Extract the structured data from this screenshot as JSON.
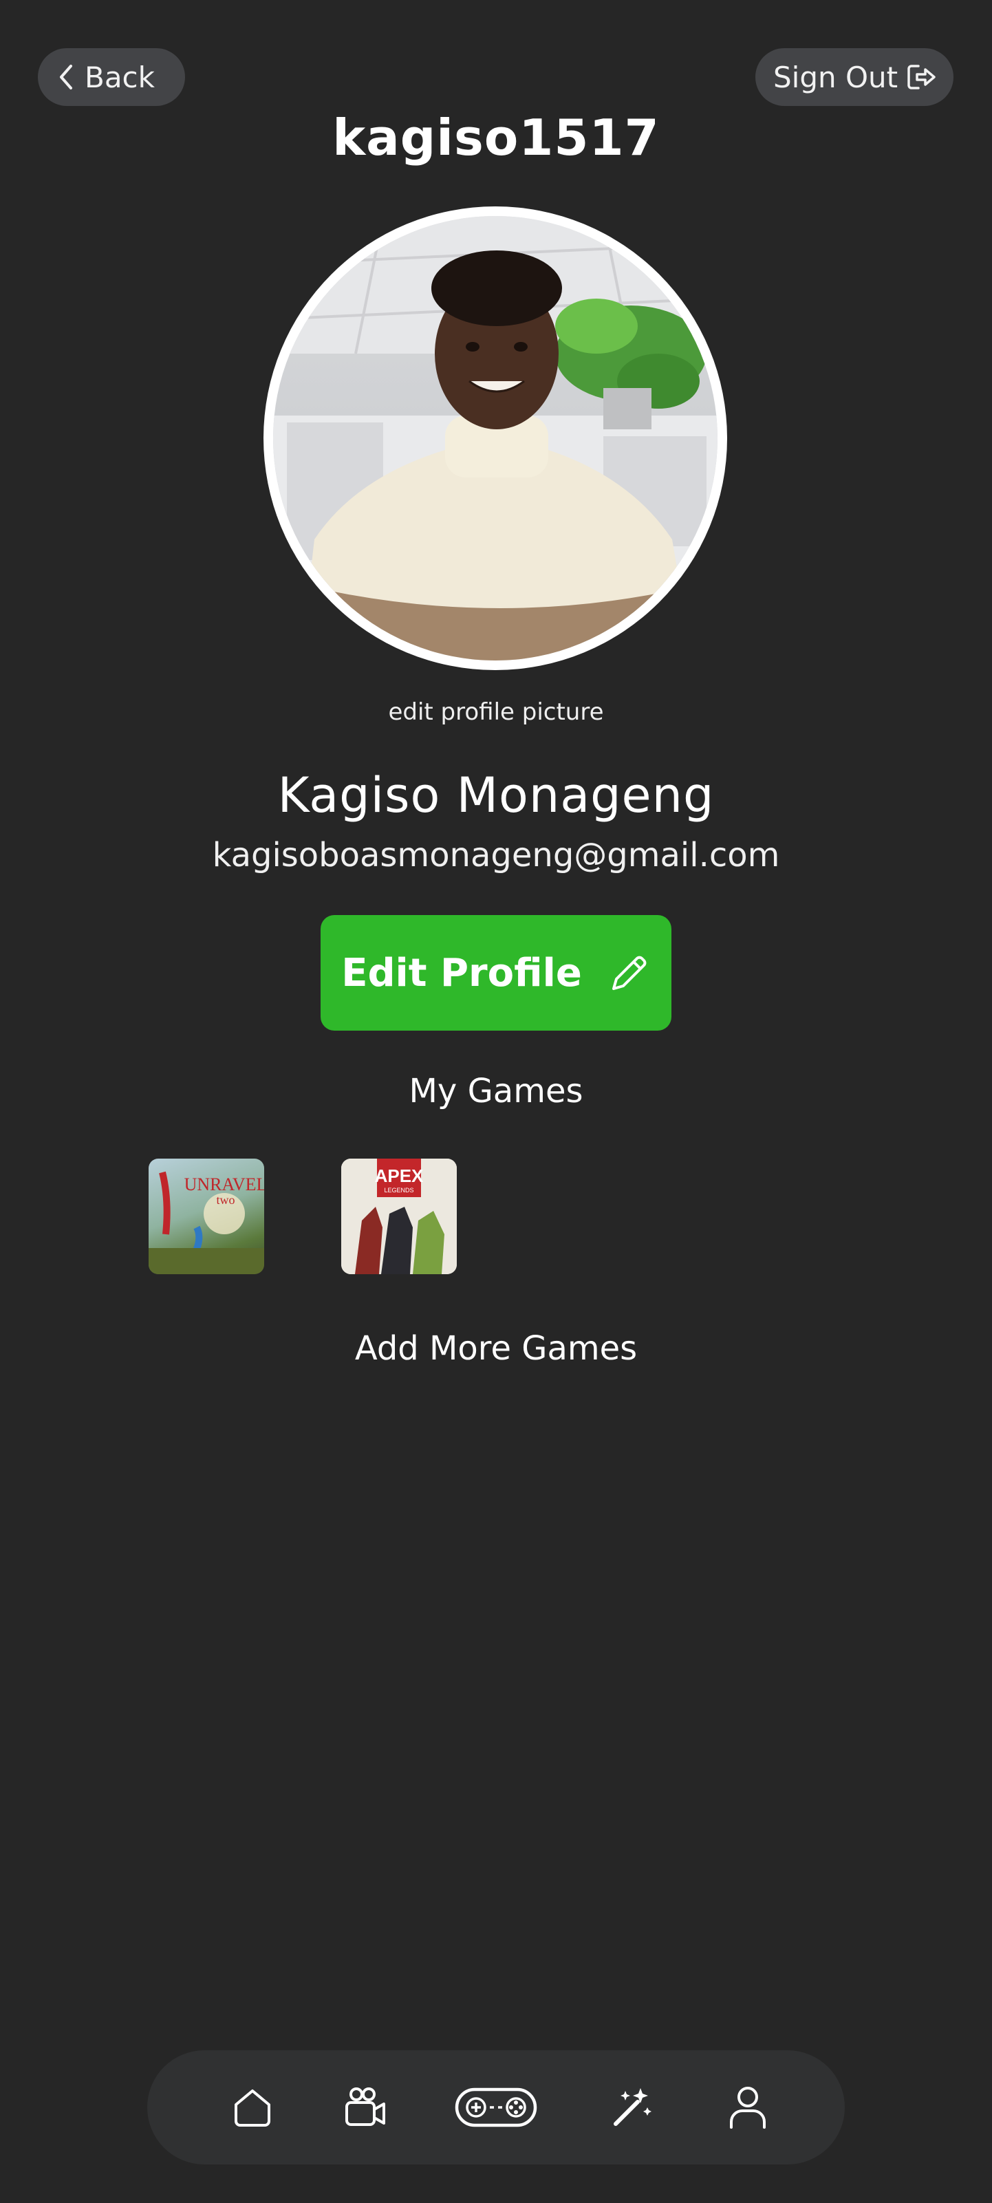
{
  "header": {
    "back_label": "Back",
    "signout_label": "Sign Out",
    "username": "kagiso1517"
  },
  "profile": {
    "edit_picture_label": "edit profile picture",
    "full_name": "Kagiso Monageng",
    "email": "kagisoboasmonageng@gmail.com",
    "edit_button_label": "Edit Profile"
  },
  "games": {
    "section_title": "My Games",
    "items": [
      {
        "title_text": "UNRAVEL",
        "subtitle_text": "two"
      },
      {
        "title_text": "APEX",
        "subtitle_text": "LEGENDS"
      }
    ],
    "add_more_label": "Add More Games"
  },
  "nav": {
    "items": [
      {
        "icon": "home-icon"
      },
      {
        "icon": "video-camera-icon"
      },
      {
        "icon": "gamepad-icon"
      },
      {
        "icon": "magic-wand-icon"
      },
      {
        "icon": "user-icon"
      }
    ]
  },
  "colors": {
    "background": "#262626",
    "pill": "#434447",
    "accent_green": "#2fb82a",
    "navbar": "#303132"
  }
}
